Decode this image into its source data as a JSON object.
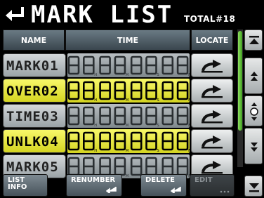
{
  "header": {
    "title": "MARK LIST",
    "total": "TOTAL#18"
  },
  "columns": {
    "name": "NAME",
    "time": "TIME",
    "locate": "LOCATE"
  },
  "rows": [
    {
      "name": "MARK01",
      "highlight": false
    },
    {
      "name": "OVER02",
      "highlight": true
    },
    {
      "name": "TIME03",
      "highlight": false
    },
    {
      "name": "UNLK04",
      "highlight": true
    },
    {
      "name": "MARK05",
      "highlight": false
    }
  ],
  "time_field": {
    "digits": 8,
    "unit_markers": [
      "H",
      "M",
      "S",
      "F"
    ],
    "icon": "digit-placeholder"
  },
  "scroll": {
    "icons": [
      "scroll-top-icon",
      "page-up-icon",
      "scroll-position-icon",
      "page-down-icon",
      "scroll-bottom-icon"
    ],
    "thumb_color": "#5cc030"
  },
  "buttons": {
    "list_info": "LIST\nINFO",
    "renumber": "RENUMBER",
    "delete": "DELETE",
    "edit": "EDIT"
  },
  "colors": {
    "highlight": "#f0f040",
    "header_bg": "#4e5a62"
  }
}
